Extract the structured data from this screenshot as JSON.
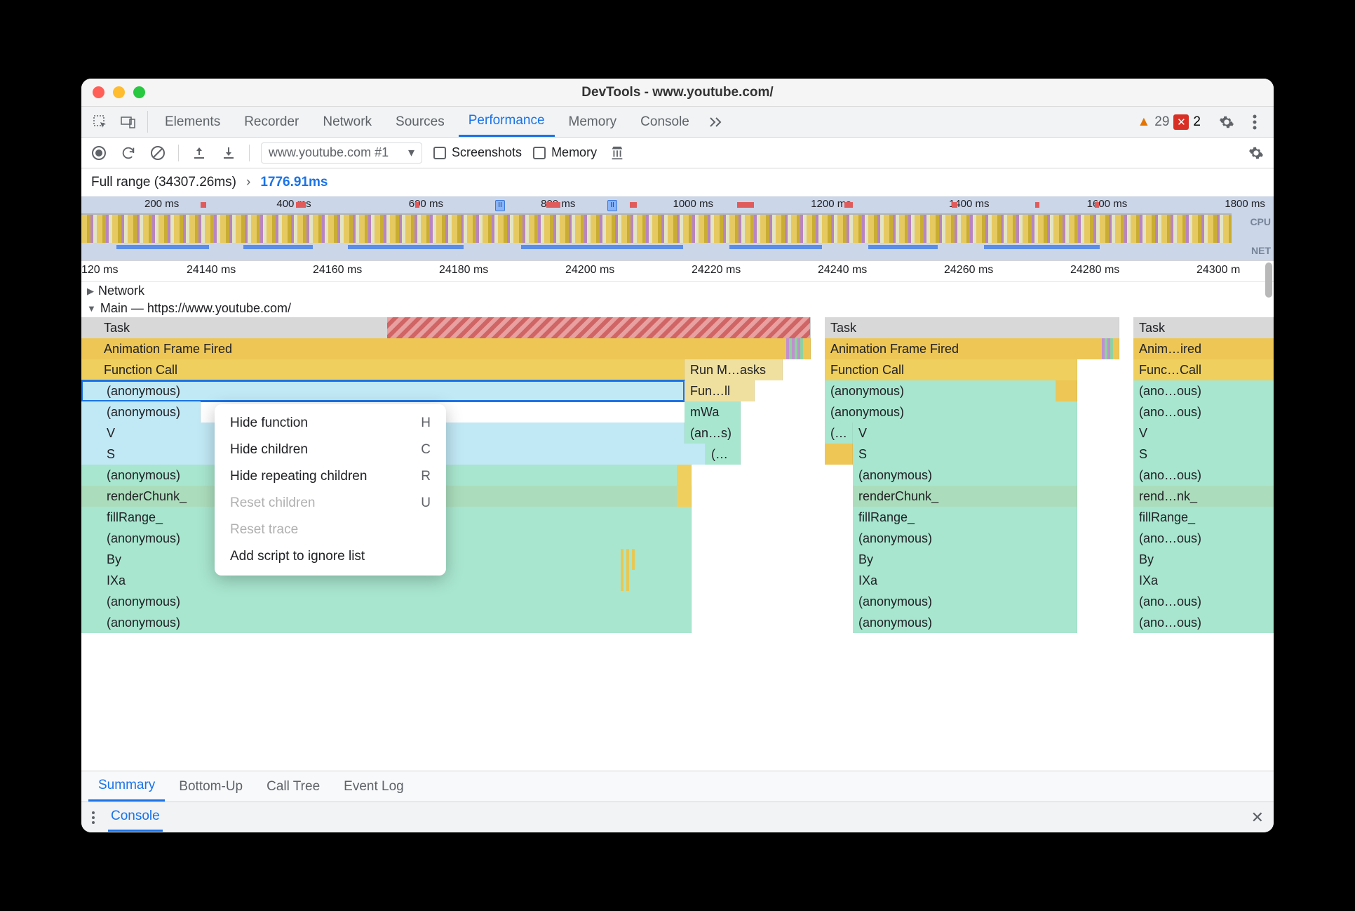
{
  "window": {
    "title": "DevTools - www.youtube.com/"
  },
  "tabs": [
    "Elements",
    "Recorder",
    "Network",
    "Sources",
    "Performance",
    "Memory",
    "Console"
  ],
  "active_tab": "Performance",
  "badges": {
    "warnings": "29",
    "errors": "2"
  },
  "toolbar": {
    "recording_selector": "www.youtube.com #1",
    "checkbox_screenshots": "Screenshots",
    "checkbox_memory": "Memory"
  },
  "range": {
    "full_label": "Full range (34307.26ms)",
    "selected": "1776.91ms"
  },
  "overview": {
    "ticks": [
      "200 ms",
      "400 ms",
      "600 ms",
      "800 ms",
      "1000 ms",
      "1200 ms",
      "1400 ms",
      "1600 ms",
      "1800 ms"
    ],
    "cpu_label": "CPU",
    "net_label": "NET"
  },
  "detailed_ticks": [
    "120 ms",
    "24140 ms",
    "24160 ms",
    "24180 ms",
    "24200 ms",
    "24220 ms",
    "24240 ms",
    "24260 ms",
    "24280 ms",
    "24300 m"
  ],
  "tracks": {
    "network_label": "Network",
    "main_label": "Main — https://www.youtube.com/"
  },
  "flame": {
    "col1": {
      "task": "Task",
      "af": "Animation Frame Fired",
      "fc": "Function Call",
      "anon1": "(anonymous)",
      "anon2": "(anonymous)",
      "v": "V",
      "s": "S",
      "anon3": "(anonymous)",
      "renderChunk": "renderChunk_",
      "fillRange": "fillRange_",
      "anon4": "(anonymous)",
      "by": "By",
      "ixa": "IXa",
      "anon5": "(anonymous)",
      "anon6": "(anonymous)",
      "run": "Run M…asks",
      "funll": "Fun…ll",
      "mwa": "mWa",
      "ans": "(an…s)",
      "paren": "(…"
    },
    "col2": {
      "task": "Task",
      "af": "Animation Frame Fired",
      "fc": "Function Call",
      "anon1": "(anonymous)",
      "anon2": "(anonymous)",
      "paren": "(…",
      "v": "V",
      "s": "S",
      "anon3": "(anonymous)",
      "renderChunk": "renderChunk_",
      "fillRange": "fillRange_",
      "anon4": "(anonymous)",
      "by": "By",
      "ixa": "IXa",
      "anon5": "(anonymous)",
      "anon6": "(anonymous)"
    },
    "col3": {
      "task": "Task",
      "af": "Anim…ired",
      "fc": "Func…Call",
      "anon1": "(ano…ous)",
      "anon2": "(ano…ous)",
      "v": "V",
      "s": "S",
      "anon3": "(ano…ous)",
      "renderChunk": "rend…nk_",
      "fillRange": "fillRange_",
      "anon4": "(ano…ous)",
      "by": "By",
      "ixa": "IXa",
      "anon5": "(ano…ous)",
      "anon6": "(ano…ous)"
    }
  },
  "context_menu": [
    {
      "label": "Hide function",
      "key": "H",
      "disabled": false
    },
    {
      "label": "Hide children",
      "key": "C",
      "disabled": false
    },
    {
      "label": "Hide repeating children",
      "key": "R",
      "disabled": false
    },
    {
      "label": "Reset children",
      "key": "U",
      "disabled": true
    },
    {
      "label": "Reset trace",
      "key": "",
      "disabled": true
    },
    {
      "label": "Add script to ignore list",
      "key": "",
      "disabled": false
    }
  ],
  "bottom_tabs": [
    "Summary",
    "Bottom-Up",
    "Call Tree",
    "Event Log"
  ],
  "active_bottom_tab": "Summary",
  "drawer": {
    "tab": "Console"
  }
}
